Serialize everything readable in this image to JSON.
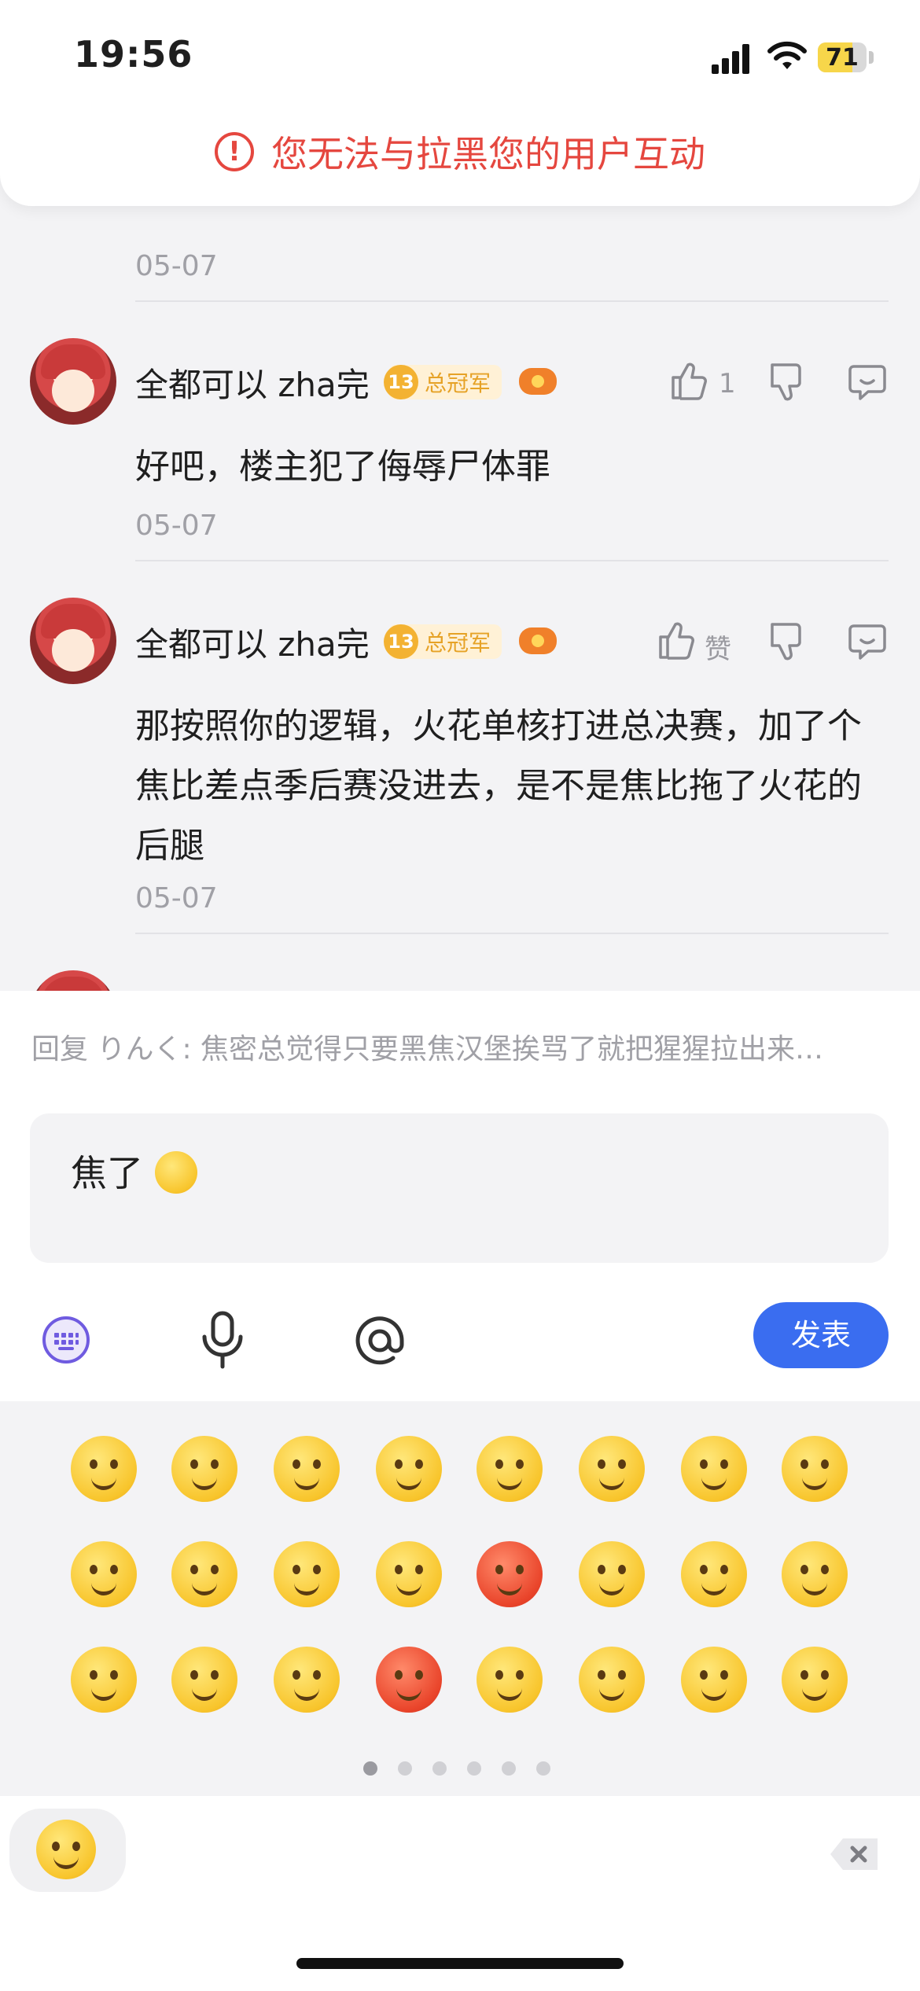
{
  "status_bar": {
    "time": "19:56",
    "battery": "71",
    "battery_fraction": 0.71
  },
  "toast": {
    "icon": "alert-circle-icon",
    "text": "您无法与拉黑您的用户互动"
  },
  "comments": [
    {
      "date": "05-07"
    },
    {
      "username": "全都可以 zha完",
      "badge_level": "13",
      "badge_text": "总冠军",
      "like_count": "1",
      "text": "好吧，楼主犯了侮辱尸体罪",
      "date": "05-07"
    },
    {
      "username": "全都可以 zha完",
      "badge_level": "13",
      "badge_text": "总冠军",
      "like_label": "赞",
      "text": "那按照你的逻辑，火花单核打进总决赛，加了个焦比差点季后赛没进去，是不是焦比拖了火花的后腿",
      "date": "05-07"
    }
  ],
  "reply_bar": {
    "prefix": "回复 りんく:",
    "quoted": "焦密总觉得只要黑焦汉堡挨骂了就把猩猩拉出来…",
    "input_text": "焦了",
    "input_emoji": "hugging-emoji"
  },
  "toolbar": {
    "keyboard_icon": "keyboard-icon",
    "mic_icon": "microphone-icon",
    "mention_icon": "at-icon",
    "send_label": "发表"
  },
  "emoji_page": {
    "pages": 6,
    "current_page": 1
  },
  "colors": {
    "accent": "#3a6df0",
    "warning": "#e5473f",
    "badge": "#f3b232"
  }
}
